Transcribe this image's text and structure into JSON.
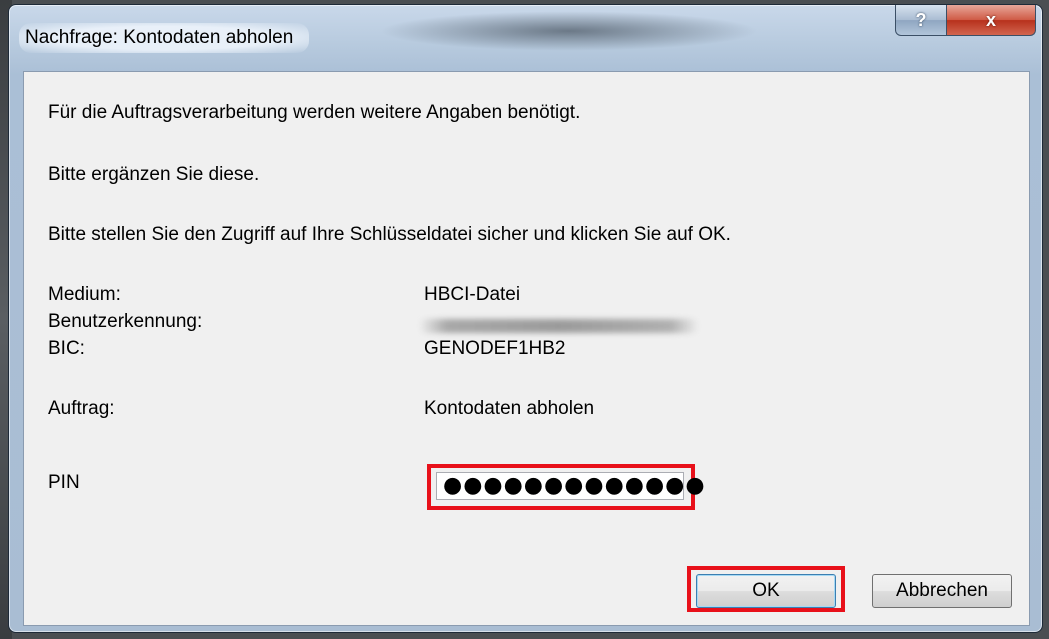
{
  "window": {
    "title": "Nachfrage: Kontodaten abholen",
    "help_label": "?",
    "close_label": "x"
  },
  "message": {
    "line1": "Für die Auftragsverarbeitung werden weitere Angaben benötigt.",
    "line2": "Bitte ergänzen Sie diese.",
    "line3": "Bitte stellen Sie den Zugriff auf Ihre Schlüsseldatei sicher und klicken Sie auf OK."
  },
  "fields": {
    "medium_label": "Medium:",
    "medium_value": "HBCI-Datei",
    "user_id_label": "Benutzerkennung:",
    "bic_label": "BIC:",
    "bic_value": "GENODEF1HB2",
    "order_label": "Auftrag:",
    "order_value": "Kontodaten abholen",
    "pin_label": "PIN",
    "pin_value": "●●●●●●●●●●●●●"
  },
  "buttons": {
    "ok_label": "OK",
    "cancel_label": "Abbrechen"
  },
  "colors": {
    "highlight": "#e8101a",
    "dialog_bg": "#f0f0f0",
    "frame": "#aabfd6"
  }
}
